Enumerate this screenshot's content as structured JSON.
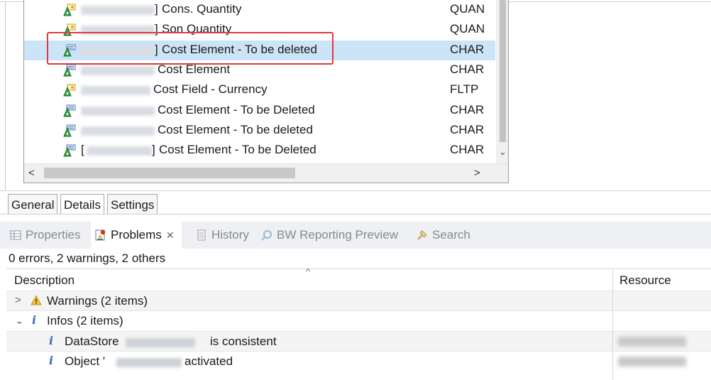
{
  "field_list": {
    "rows": [
      {
        "bracket": "]",
        "name": "Cons. Quantity",
        "type": "QUAN",
        "icon": "keyfigure-quantity-icon",
        "selected": false
      },
      {
        "bracket": "]",
        "name": "Son Quantity",
        "type": "QUAN",
        "icon": "keyfigure-quantity-icon",
        "selected": false
      },
      {
        "bracket": "]",
        "name": "Cost Element - To be deleted",
        "type": "CHAR",
        "icon": "characteristic-icon",
        "selected": true
      },
      {
        "bracket": "",
        "name": "Cost Element",
        "type": "CHAR",
        "icon": "characteristic-icon",
        "selected": false
      },
      {
        "bracket": "",
        "name": "Cost Field - Currency",
        "type": "FLTP",
        "icon": "keyfigure-quantity-icon",
        "selected": false
      },
      {
        "bracket": "",
        "name": "Cost Element - To be Deleted",
        "type": "CHAR",
        "icon": "characteristic-icon",
        "selected": false
      },
      {
        "bracket": "",
        "name": "Cost Element - To be deleted",
        "type": "CHAR",
        "icon": "characteristic-icon",
        "selected": false
      },
      {
        "bracket": "[",
        "bracket_close": "]",
        "name": "Cost Element - To be Deleted",
        "type": "CHAR",
        "icon": "characteristic-icon",
        "selected": false
      }
    ],
    "scroll_left": "<",
    "scroll_right": ">",
    "scroll_down": "⌄",
    "highlight_color": "#e0393e",
    "selection_color": "#cce4f7"
  },
  "editor_tabs": [
    {
      "label": "General",
      "active": false
    },
    {
      "label": "Details",
      "active": true
    },
    {
      "label": "Settings",
      "active": false
    }
  ],
  "view_tabs": [
    {
      "label": "Properties",
      "icon": "properties-icon",
      "active": false
    },
    {
      "label": "Problems",
      "icon": "problems-icon",
      "active": true,
      "close": "✕"
    },
    {
      "label": "History",
      "icon": "history-icon",
      "active": false
    },
    {
      "label": "BW Reporting Preview",
      "icon": "reporting-preview-icon",
      "active": false
    },
    {
      "label": "Search",
      "icon": "search-icon",
      "active": false
    }
  ],
  "problems": {
    "summary": "0 errors, 2 warnings, 2 others",
    "columns": {
      "description": "Description",
      "resource": "Resource"
    },
    "sort_caret": "^",
    "groups": [
      {
        "twisty": ">",
        "icon": "warning-icon",
        "label": "Warnings (2 items)"
      },
      {
        "twisty": "⌄",
        "icon": "info-icon",
        "label": "Infos (2 items)"
      }
    ],
    "items": [
      {
        "icon": "info-icon",
        "prefix": "DataStore",
        "suffix": "is consistent"
      },
      {
        "icon": "info-icon",
        "prefix": "Object '",
        "suffix": "activated"
      }
    ]
  }
}
